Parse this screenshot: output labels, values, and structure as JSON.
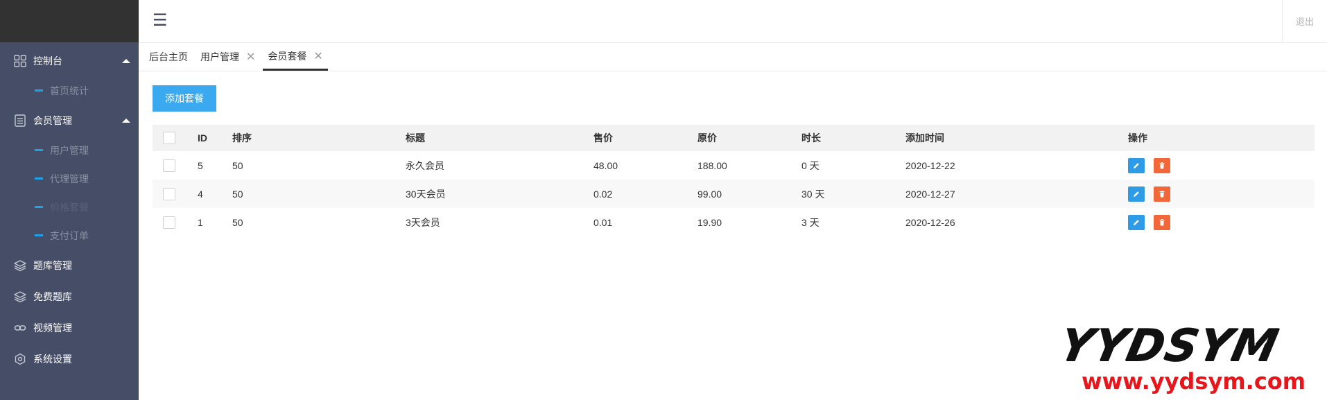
{
  "header": {
    "logout_label": "退出",
    "menu_icon": "menu-icon"
  },
  "sidebar": {
    "groups": [
      {
        "label": "控制台",
        "icon": "dashboard-grid-icon",
        "expanded": true,
        "items": [
          {
            "label": "首页统计"
          }
        ]
      },
      {
        "label": "会员管理",
        "icon": "document-list-icon",
        "expanded": true,
        "items": [
          {
            "label": "用户管理"
          },
          {
            "label": "代理管理"
          },
          {
            "label": "价格套餐"
          },
          {
            "label": "支付订单"
          }
        ]
      },
      {
        "label": "题库管理",
        "icon": "layers-icon"
      },
      {
        "label": "免费题库",
        "icon": "layers-icon"
      },
      {
        "label": "视频管理",
        "icon": "link-icon"
      },
      {
        "label": "系统设置",
        "icon": "gear-icon"
      }
    ]
  },
  "tabs": [
    {
      "label": "后台主页",
      "closable": false
    },
    {
      "label": "用户管理",
      "closable": true
    },
    {
      "label": "会员套餐",
      "closable": true,
      "active": true
    }
  ],
  "toolbar": {
    "add_label": "添加套餐"
  },
  "table": {
    "headers": {
      "id": "ID",
      "sort": "排序",
      "title": "标题",
      "price": "售价",
      "original": "原价",
      "duration": "时长",
      "created": "添加时间",
      "ops": "操作"
    },
    "rows": [
      {
        "id": "5",
        "sort": "50",
        "title": "永久会员",
        "price": "48.00",
        "original": "188.00",
        "duration": "0 天",
        "created": "2020-12-22"
      },
      {
        "id": "4",
        "sort": "50",
        "title": "30天会员",
        "price": "0.02",
        "original": "99.00",
        "duration": "30 天",
        "created": "2020-12-27"
      },
      {
        "id": "1",
        "sort": "50",
        "title": "3天会员",
        "price": "0.01",
        "original": "19.90",
        "duration": "3 天",
        "created": "2020-12-26"
      }
    ]
  },
  "watermark": {
    "top": "YYDSYM",
    "bottom": "www.yydsym.com"
  },
  "colors": {
    "sidebar_bg": "#464d66",
    "accent": "#3aa9f0",
    "edit": "#2d9be6",
    "delete": "#f2673a",
    "watermark_red": "#e8151b"
  }
}
